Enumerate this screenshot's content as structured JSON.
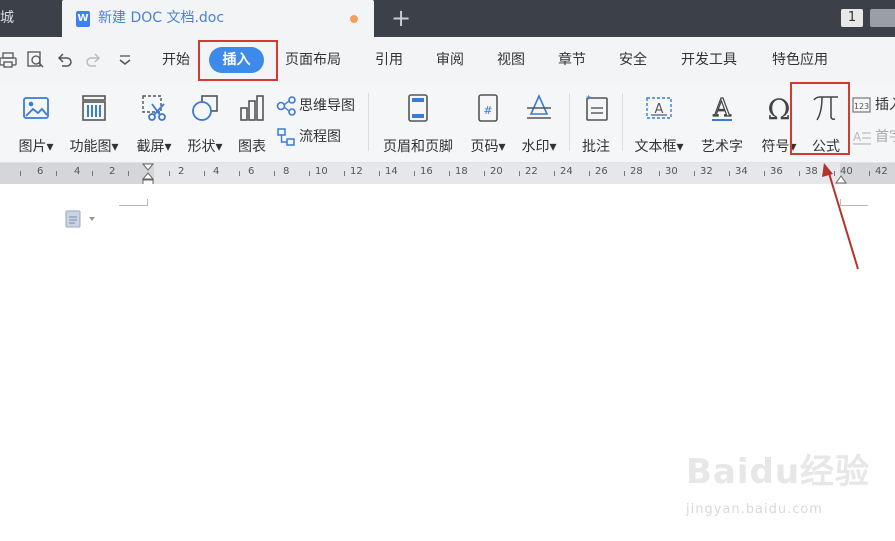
{
  "titlebar": {
    "prev_tab_label": "城",
    "active_tab_title": "新建 DOC 文档.doc",
    "doc_icon_letter": "W",
    "new_tab_symbol": "+",
    "window_count": "1"
  },
  "menu": {
    "items": [
      "开始",
      "插入",
      "页面布局",
      "引用",
      "审阅",
      "视图",
      "章节",
      "安全",
      "开发工具",
      "特色应用"
    ],
    "active": "插入"
  },
  "ribbon": {
    "picture": "图片",
    "function_chart": "功能图",
    "screenshot": "截屏",
    "shape": "形状",
    "chart": "图表",
    "mindmap": "思维导图",
    "flowchart": "流程图",
    "header_footer": "页眉和页脚",
    "page_number": "页码",
    "watermark": "水印",
    "comment": "批注",
    "textbox": "文本框",
    "wordart": "艺术字",
    "symbol": "符号",
    "formula": "公式",
    "insert_number": "插入",
    "dropcap": "首字"
  },
  "ruler": {
    "left_labels": [
      "6",
      "4",
      "2"
    ],
    "right_labels": [
      "2",
      "4",
      "6",
      "8",
      "10",
      "12",
      "14",
      "16",
      "18",
      "20",
      "22",
      "24",
      "26",
      "28",
      "30",
      "32",
      "34",
      "36",
      "38",
      "40",
      "42"
    ]
  },
  "watermark": {
    "logo": "Baidu经验",
    "url": "jingyan.baidu.com"
  },
  "colors": {
    "accent_blue": "#3e8ae8",
    "highlight_red": "#d23b32",
    "titlebar_dark": "#3c4049"
  }
}
